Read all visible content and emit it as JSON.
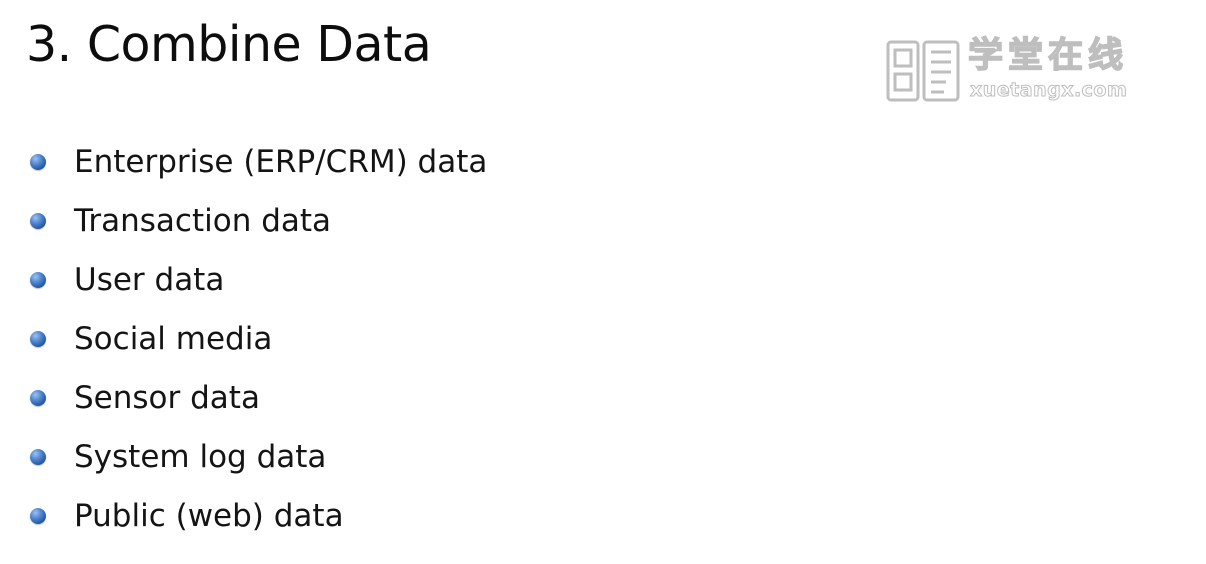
{
  "slide": {
    "title": "3. Combine Data",
    "bullets": [
      "Enterprise (ERP/CRM) data",
      "Transaction data",
      "User data",
      "Social media",
      "Sensor data",
      "System log data",
      "Public (web) data"
    ]
  },
  "watermark": {
    "chinese": "学堂在线",
    "url": "xuetangx.com",
    "logo_icon": "xuetangx-logo-icon"
  },
  "colors": {
    "bullet": "#2f63b0",
    "text": "#141414",
    "watermark": "#8a8a8a"
  }
}
